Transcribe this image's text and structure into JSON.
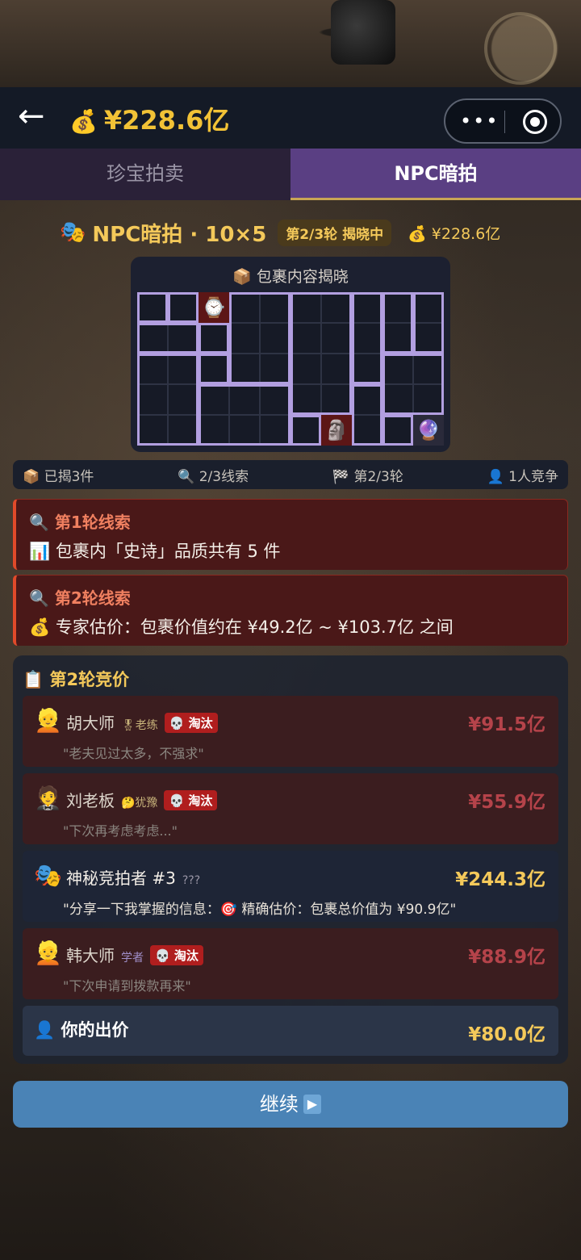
{
  "header": {
    "back_icon": "←",
    "money_icon": "💰",
    "money": "¥228.6亿",
    "menu_icon": "•••",
    "close_icon": "◉"
  },
  "tabs": [
    {
      "label": "珍宝拍卖",
      "active": false
    },
    {
      "label": "NPC暗拍",
      "active": true
    }
  ],
  "auction": {
    "mask_icon": "🎭",
    "title": "NPC暗拍 · 10×5",
    "round_badge": "第2/3轮 揭晓中",
    "wallet": "💰 ¥228.6亿"
  },
  "grid_panel": {
    "title": "📦 包裹内容揭晓",
    "cols": 10,
    "rows": 5,
    "items": [
      {
        "name": "watch",
        "icon": "⌚",
        "col": 2,
        "row": 0
      },
      {
        "name": "golden-idol",
        "icon": "🗿",
        "col": 6,
        "row": 4
      },
      {
        "name": "mystic-orb",
        "icon": "🔮",
        "col": 9,
        "row": 4
      }
    ]
  },
  "stats": {
    "revealed": "📦 已揭3件",
    "clues": "🔍 2/3线索",
    "round": "🏁 第2/3轮",
    "competitors": "👤 1人竞争"
  },
  "clues": [
    {
      "title": "🔍 第1轮线索",
      "text": "📊 包裹内「史诗」品质共有 5 件"
    },
    {
      "title": "🔍 第2轮线索",
      "text": "💰 专家估价：包裹价值约在 ¥49.2亿 ~ ¥103.7亿 之间"
    }
  ],
  "bidding": {
    "title": "📋 第2轮竞价",
    "bidders": [
      {
        "avatar": "👱",
        "name": "胡大师",
        "tag": "🎖老练",
        "status": "💀 淘汰",
        "amount": "¥91.5亿",
        "quote": "\"老夫见过太多，不强求\""
      },
      {
        "avatar": "🤵",
        "name": "刘老板",
        "tag": "🤔犹豫",
        "status": "💀 淘汰",
        "amount": "¥55.9亿",
        "quote": "\"下次再考虑考虑...\""
      },
      {
        "avatar": "🎭",
        "name": "神秘竞拍者 #3",
        "tag": "???",
        "status": "",
        "amount": "¥244.3亿",
        "quote": "\"分享一下我掌握的信息：🎯 精确估价：包裹总价值为 ¥90.9亿\""
      },
      {
        "avatar": "👱",
        "name": "韩大师",
        "tag": "学者",
        "status": "💀 淘汰",
        "amount": "¥88.9亿",
        "quote": "\"下次申请到拨款再来\""
      }
    ],
    "you": {
      "icon": "👤",
      "label": "你的出价",
      "amount": "¥80.0亿"
    }
  },
  "continue": {
    "label": "继续",
    "icon": "▶"
  }
}
